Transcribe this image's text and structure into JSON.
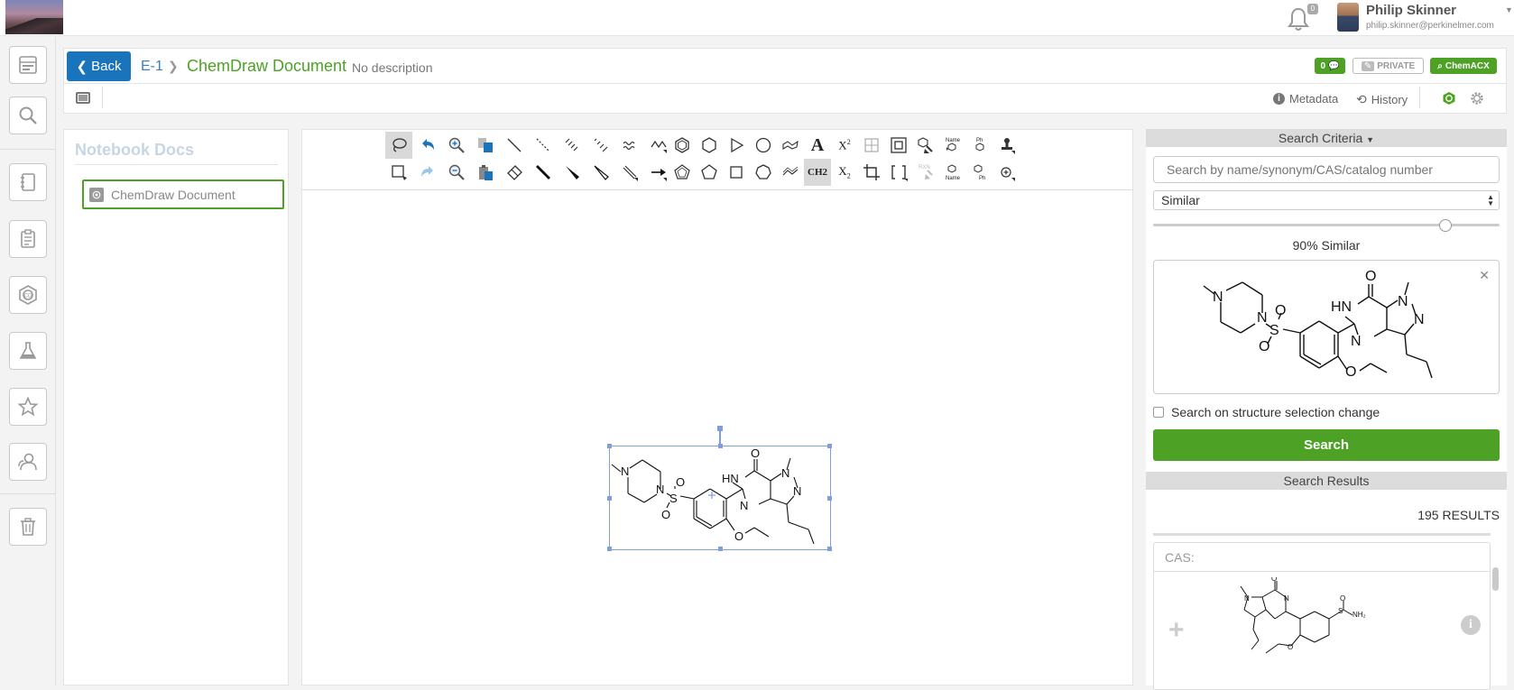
{
  "topbar": {
    "notification_count": "0",
    "user_name": "Philip Skinner",
    "user_email": "philip.skinner@perkinelmer.com"
  },
  "header": {
    "back_label": "Back",
    "crumb": "E-1",
    "title": "ChemDraw Document",
    "description": "No description",
    "comments_count": "0",
    "private_label": "PRIVATE",
    "chemacx_label": "ChemACX"
  },
  "subbar": {
    "metadata_label": "Metadata",
    "history_label": "History"
  },
  "notebook": {
    "title": "Notebook Docs",
    "items": [
      {
        "label": "ChemDraw Document"
      }
    ]
  },
  "toolbar": {
    "text_tool": "A",
    "superscript_label": "X",
    "subscript_label": "X",
    "ch2_label": "CH2",
    "name_label": "Name",
    "ph_label": "Ph",
    "rxn_label": "RXN"
  },
  "search": {
    "header": "Search Criteria",
    "input_placeholder": "Search by name/synonym/CAS/catalog number",
    "mode": "Similar",
    "similarity_percent": 90,
    "similarity_label": "90% Similar",
    "on_change_label": "Search on structure selection change",
    "button_label": "Search",
    "results_header": "Search Results",
    "results_count": "195 RESULTS",
    "result_cas_label": "CAS:"
  },
  "colors": {
    "brand_green": "#4da226",
    "back_blue": "#1a74bb",
    "selection_blue": "#7e9ee0"
  }
}
